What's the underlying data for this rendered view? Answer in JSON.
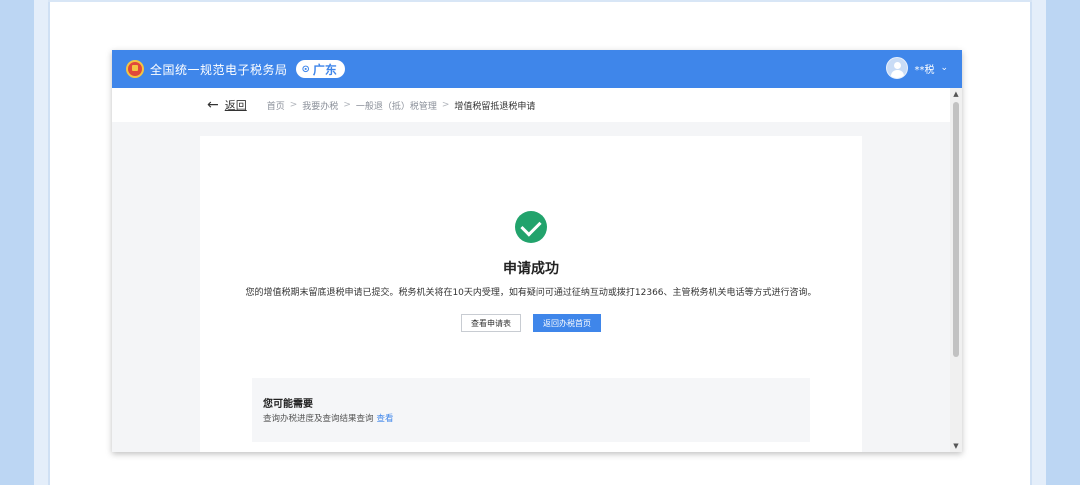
{
  "header": {
    "site_title": "全国统一规范电子税务局",
    "region": "广东",
    "user_name": "**税"
  },
  "nav": {
    "back_label": "返回",
    "breadcrumbs": [
      "首页",
      "我要办税",
      "一般退（抵）税管理",
      "增值税留抵退税申请"
    ]
  },
  "result": {
    "title": "申请成功",
    "description": "您的增值税期末留底退税申请已提交。税务机关将在10天内受理，如有疑问可通过征纳互动或拨打12366、主管税务机关电话等方式进行咨询。",
    "buttons": {
      "view_form": "查看申请表",
      "back_home": "返回办税首页"
    }
  },
  "suggestions": {
    "title": "您可能需要",
    "item_text": "查询办税进度及查询结果查询",
    "item_link": "查看"
  },
  "colors": {
    "brand_blue": "#3f86ea",
    "success_green": "#22a36c"
  }
}
